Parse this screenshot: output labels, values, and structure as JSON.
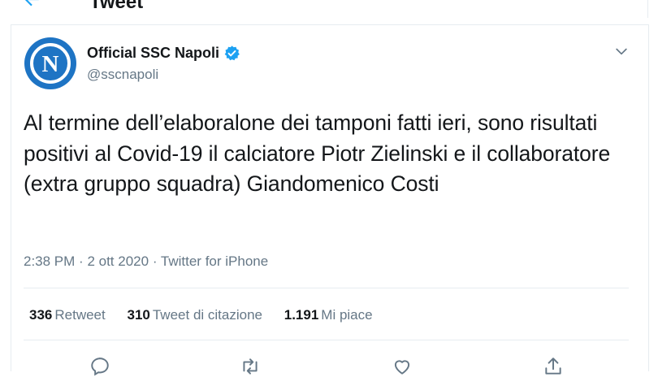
{
  "header": {
    "title": "Tweet"
  },
  "tweet": {
    "display_name": "Official SSC Napoli",
    "handle": "@sscnapoli",
    "avatar_letter": "N",
    "text": "Al termine dell’elaboralone dei tamponi fatti ieri, sono risultati positivi al Covid-19 il calciatore Piotr Zielinski e il collaboratore (extra gruppo squadra) Giandomenico Costi",
    "time": "2:38 PM",
    "date": "2 ott 2020",
    "source": "Twitter for iPhone",
    "separator": "·"
  },
  "stats": {
    "retweets_count": "336",
    "retweets_label": "Retweet",
    "quotes_count": "310",
    "quotes_label": "Tweet di citazione",
    "likes_count": "1.191",
    "likes_label": "Mi piace"
  },
  "colors": {
    "accent": "#1da1f2",
    "text": "#14171a",
    "secondary_text": "#657786",
    "border": "#e6ecf0",
    "napoli_blue": "#1e74c4"
  },
  "icons": [
    "back-arrow-icon",
    "verified-badge-icon",
    "chevron-down-icon",
    "reply-icon",
    "retweet-icon",
    "like-icon",
    "share-icon"
  ]
}
